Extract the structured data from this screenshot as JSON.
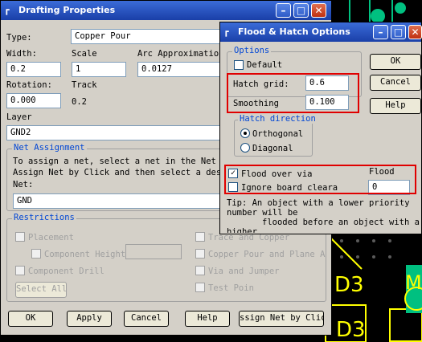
{
  "drafting": {
    "title": "Drafting Properties",
    "type_label": "Type:",
    "type_value": "Copper Pour",
    "width_label": "Width:",
    "width_value": "0.2",
    "scale_label": "Scale",
    "scale_value": "1",
    "arc_label": "Arc Approximation",
    "arc_value": "0.0127",
    "rotation_label": "Rotation:",
    "rotation_value": "0.000",
    "track_label": "Track",
    "track_value": "0.2",
    "layer_label": "Layer",
    "layer_value": "GND2",
    "net_group": "Net Assignment",
    "net_help_1": "To assign a net, select a net in the Net li",
    "net_help_2": "Assign Net by Click and then select a desi",
    "net_label": "Net:",
    "net_value": "GND",
    "restrictions_group": "Restrictions",
    "placement": "Placement",
    "component_height": "Component Height",
    "component_drill": "Component Drill",
    "select_all": "Select All",
    "trace_copper": "Trace and Copper",
    "copper_pour_plane": "Copper Pour and Plane A",
    "via_jumper": "Via and Jumper",
    "test_point": "Test Poin",
    "ok": "OK",
    "apply": "Apply",
    "cancel": "Cancel",
    "help": "Help",
    "assign_net": "ssign Net by Clic"
  },
  "flood": {
    "title": "Flood & Hatch Options",
    "options_group": "Options",
    "default_label": "Default",
    "hatch_grid_label": "Hatch grid:",
    "hatch_grid_value": "0.6",
    "smoothing_label": "Smoothing",
    "smoothing_value": "0.100",
    "hatch_dir_group": "Hatch direction",
    "orthogonal": "Orthogonal",
    "diagonal": "Diagonal",
    "flood_over_via": "Flood over via",
    "ignore_board": "Ignore board cleara",
    "flood_label": "Flood",
    "flood_value": "0",
    "tip_1": "Tip: An object with a lower priority",
    "tip_2": "number will be",
    "tip_3": "flooded before an object with a",
    "tip_4": "higher",
    "ok": "OK",
    "cancel": "Cancel",
    "help": "Help"
  },
  "pcb": {
    "label_d3_a": "D3",
    "label_d3_b": "D3",
    "label_m": "M"
  },
  "colors": {
    "titlebar": "#1a3fa8",
    "dialog_bg": "#d4d0c8",
    "highlight": "#e00000",
    "pcb_yellow": "#ffff00",
    "pcb_green": "#00c080"
  }
}
